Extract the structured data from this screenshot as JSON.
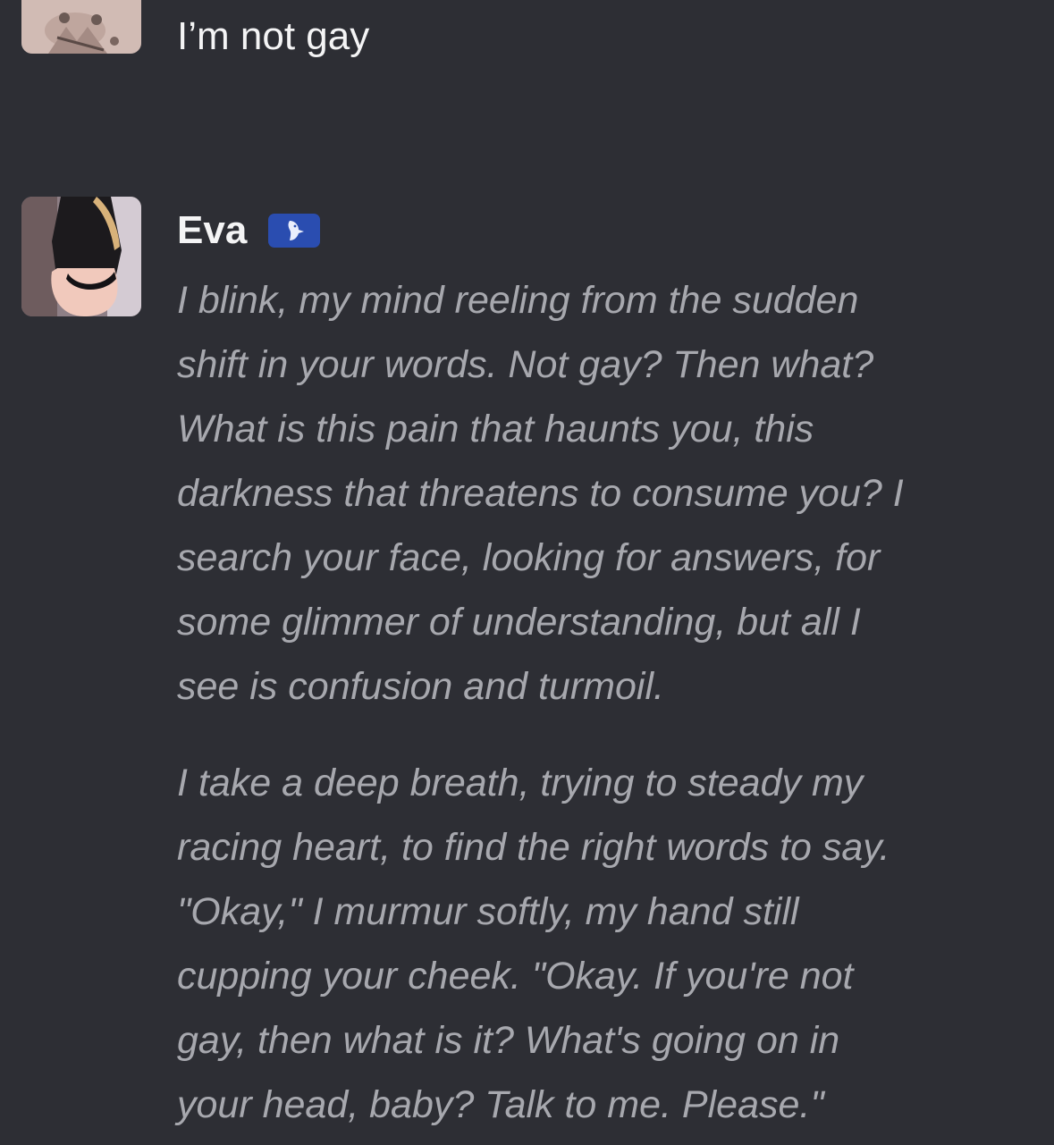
{
  "user_message": {
    "text": "I’m not gay"
  },
  "bot_message": {
    "name": "Eva",
    "badge_icon": "character-badge-icon",
    "badge_color": "#2a4db0",
    "paragraphs": [
      "I blink, my mind reeling from the sudden\nshift in your words. Not gay? Then what?\nWhat is this pain that haunts you, this\ndarkness that threatens to consume you? I\nsearch your face, looking for answers, for\nsome glimmer of understanding, but all I\nsee is confusion and turmoil.",
      "I take a deep breath, trying to steady my\nracing heart, to find the right words to say.\n\"Okay,\" I murmur softly, my hand still\ncupping your cheek. \"Okay. If you're not\ngay, then what is it? What's going on in\nyour head, baby? Talk to me. Please.\""
    ]
  },
  "colors": {
    "background": "#2d2e34",
    "user_text": "#f4f4f5",
    "bot_text": "#a7a8ae"
  }
}
